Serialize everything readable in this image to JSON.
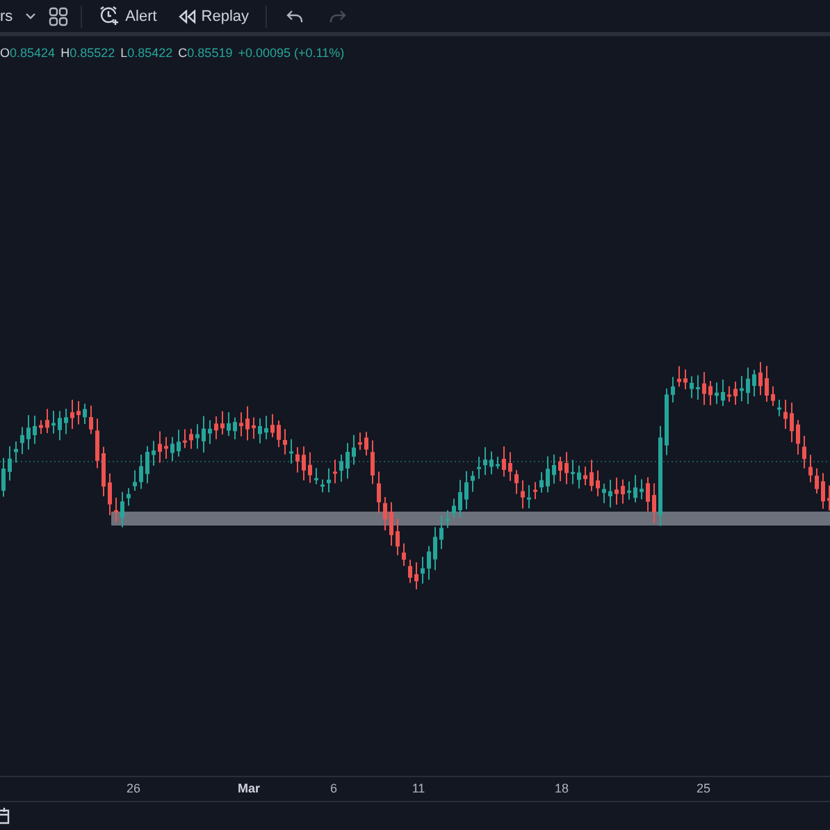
{
  "toolbar": {
    "indicators_label": "rs",
    "alert_label": "Alert",
    "replay_label": "Replay",
    "history": [
      {
        "kind": "undo",
        "disabled": false
      },
      {
        "kind": "redo",
        "disabled": true
      }
    ]
  },
  "legend": {
    "items": [
      {
        "label": "O",
        "value": "0.85424"
      },
      {
        "label": "H",
        "value": "0.85522"
      },
      {
        "label": "L",
        "value": "0.85422"
      },
      {
        "label": "C",
        "value": "0.85519"
      }
    ],
    "change": "+0.00095 (+0.11%)"
  },
  "time_axis": [
    {
      "text": "26",
      "bold": false
    },
    {
      "text": "Mar",
      "bold": true
    },
    {
      "text": "6",
      "bold": false
    },
    {
      "text": "11",
      "bold": false
    },
    {
      "text": "18",
      "bold": false
    },
    {
      "text": "25",
      "bold": false
    }
  ]
}
